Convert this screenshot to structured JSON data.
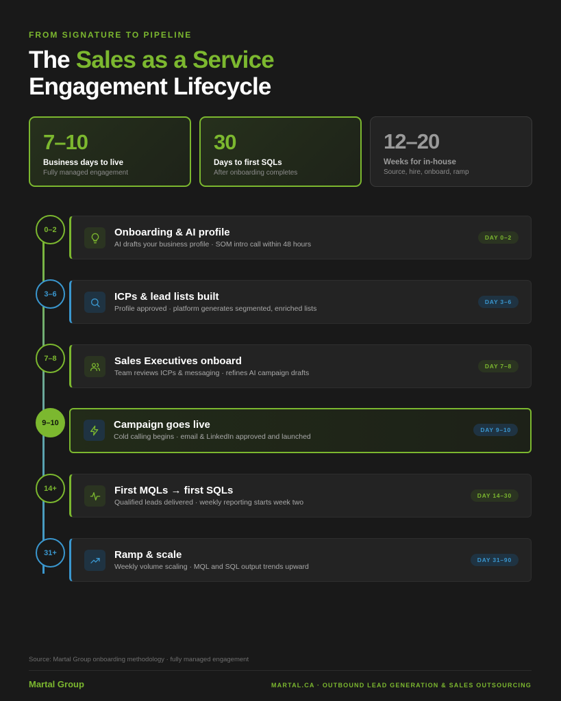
{
  "header": {
    "eyebrow": "FROM SIGNATURE TO PIPELINE",
    "title_lead": "The ",
    "title_accent": "Sales as a Service",
    "title_line2": "Engagement Lifecycle"
  },
  "stats": [
    {
      "value": "7–10",
      "label": "Business days to live",
      "sub": "Fully managed engagement"
    },
    {
      "value": "30",
      "label": "Days to first SQLs",
      "sub": "After onboarding completes"
    },
    {
      "value": "12–20",
      "label": "Weeks for in-house",
      "sub": "Source, hire, onboard, ramp"
    }
  ],
  "steps": [
    {
      "node": "0–2",
      "title": "Onboarding & AI profile",
      "desc": "AI drafts your business profile · SOM intro call within 48 hours",
      "badge": "DAY 0–2",
      "icon": "lightbulb-icon"
    },
    {
      "node": "3–6",
      "title": "ICPs & lead lists built",
      "desc": "Profile approved · platform generates segmented, enriched lists",
      "badge": "DAY 3–6",
      "icon": "search-icon"
    },
    {
      "node": "7–8",
      "title": "Sales Executives onboard",
      "desc": "Team reviews ICPs & messaging · refines AI campaign drafts",
      "badge": "DAY 7–8",
      "icon": "users-icon"
    },
    {
      "node": "9–10",
      "title": "Campaign goes live",
      "desc": "Cold calling begins · email & LinkedIn approved and launched",
      "badge": "DAY 9–10",
      "icon": "lightning-icon"
    },
    {
      "node": "14+",
      "title": "First MQLs → first SQLs",
      "desc": "Qualified leads delivered · weekly reporting starts week two",
      "badge": "DAY 14–30",
      "icon": "activity-icon"
    },
    {
      "node": "31+",
      "title": "Ramp & scale",
      "desc": "Weekly volume scaling · MQL and SQL output trends upward",
      "badge": "DAY 31–90",
      "icon": "trend-up-icon"
    }
  ],
  "footer": {
    "source": "Source: Martal Group onboarding methodology · fully managed engagement",
    "brand": "Martal Group",
    "tagline": "MARTAL.CA · OUTBOUND LEAD GENERATION & SALES OUTSOURCING"
  },
  "colors": {
    "accent_green": "#7cb82f",
    "accent_blue": "#3a97cf",
    "background": "#191919"
  }
}
